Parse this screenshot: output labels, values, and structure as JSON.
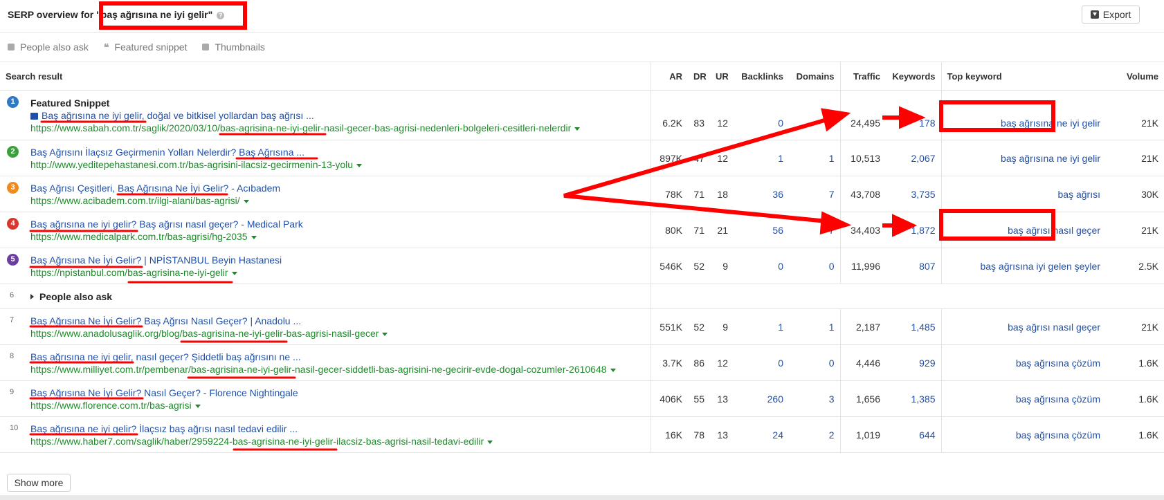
{
  "header": {
    "title_prefix": "SERP overview for ",
    "query": "\"baş ağrısına ne iyi gelir\"",
    "help": "?",
    "export_label": "Export"
  },
  "features": [
    {
      "label": "People also ask",
      "icon": "chat-icon"
    },
    {
      "label": "Featured snippet",
      "icon": "quote-icon"
    },
    {
      "label": "Thumbnails",
      "icon": "image-icon"
    }
  ],
  "columns": {
    "result": "Search result",
    "ar": "AR",
    "dr": "DR",
    "ur": "UR",
    "backlinks": "Backlinks",
    "domains": "Domains",
    "traffic": "Traffic",
    "keywords": "Keywords",
    "top_keyword": "Top keyword",
    "volume": "Volume"
  },
  "featured_label": "Featured Snippet",
  "paa_label": "People also ask",
  "paa_pos": "6",
  "rows": [
    {
      "pos": "1",
      "badge_color": "#2f78c4",
      "title": "Baş ağrısına ne iyi gelir, doğal ve bitkisel yollardan baş ağrısı ...",
      "url": "https://www.sabah.com.tr/saglik/2020/03/10/bas-agrisina-ne-iyi-gelir-nasil-gecer-bas-agrisi-nedenleri-bolgeleri-cesitleri-nelerdir",
      "ar": "6.2K",
      "dr": "83",
      "ur": "12",
      "backlinks": "0",
      "domains": "0",
      "traffic": "24,495",
      "keywords": "178",
      "top_keyword": "baş ağrısına ne iyi gelir",
      "volume": "21K"
    },
    {
      "pos": "2",
      "badge_color": "#3aa03a",
      "title": "Baş Ağrısını İlaçsız Geçirmenin Yolları Nelerdir? Baş Ağrısına ...",
      "url": "http://www.yeditepehastanesi.com.tr/bas-agrisini-ilacsiz-gecirmenin-13-yolu",
      "ar": "897K",
      "dr": "47",
      "ur": "12",
      "backlinks": "1",
      "domains": "1",
      "traffic": "10,513",
      "keywords": "2,067",
      "top_keyword": "baş ağrısına ne iyi gelir",
      "volume": "21K"
    },
    {
      "pos": "3",
      "badge_color": "#f08a1c",
      "title": "Baş Ağrısı Çeşitleri, Baş Ağrısına Ne İyi Gelir? - Acıbadem",
      "url": "https://www.acibadem.com.tr/ilgi-alani/bas-agrisi/",
      "ar": "78K",
      "dr": "71",
      "ur": "18",
      "backlinks": "36",
      "domains": "7",
      "traffic": "43,708",
      "keywords": "3,735",
      "top_keyword": "baş ağrısı",
      "volume": "30K"
    },
    {
      "pos": "4",
      "badge_color": "#d9362c",
      "title": "Baş ağrısına ne iyi gelir? Baş ağrısı nasıl geçer? - Medical Park",
      "url": "https://www.medicalpark.com.tr/bas-agrisi/hg-2035",
      "ar": "80K",
      "dr": "71",
      "ur": "21",
      "backlinks": "56",
      "domains": "7",
      "traffic": "34,403",
      "keywords": "1,872",
      "top_keyword": "baş ağrısı nasıl geçer",
      "volume": "21K"
    },
    {
      "pos": "5",
      "badge_color": "#6a3fa0",
      "title": "Baş Ağrısına Ne İyi Gelir? | NPİSTANBUL Beyin Hastanesi",
      "url": "https://npistanbul.com/bas-agrisina-ne-iyi-gelir",
      "ar": "546K",
      "dr": "52",
      "ur": "9",
      "backlinks": "0",
      "domains": "0",
      "traffic": "11,996",
      "keywords": "807",
      "top_keyword": "baş ağrısına iyi gelen şeyler",
      "volume": "2.5K"
    },
    {
      "pos": "7",
      "badge_color": "",
      "title": "Baş Ağrısına Ne İyi Gelir? Baş Ağrısı Nasıl Geçer? | Anadolu ...",
      "url": "https://www.anadolusaglik.org/blog/bas-agrisina-ne-iyi-gelir-bas-agrisi-nasil-gecer",
      "ar": "551K",
      "dr": "52",
      "ur": "9",
      "backlinks": "1",
      "domains": "1",
      "traffic": "2,187",
      "keywords": "1,485",
      "top_keyword": "baş ağrısı nasıl geçer",
      "volume": "21K"
    },
    {
      "pos": "8",
      "badge_color": "",
      "title": "Baş ağrısına ne iyi gelir, nasıl geçer? Şiddetli baş ağrısını ne ...",
      "url": "https://www.milliyet.com.tr/pembenar/bas-agrisina-ne-iyi-gelir-nasil-gecer-siddetli-bas-agrisini-ne-gecirir-evde-dogal-cozumler-2610648",
      "ar": "3.7K",
      "dr": "86",
      "ur": "12",
      "backlinks": "0",
      "domains": "0",
      "traffic": "4,446",
      "keywords": "929",
      "top_keyword": "baş ağrısına çözüm",
      "volume": "1.6K"
    },
    {
      "pos": "9",
      "badge_color": "",
      "title": "Baş Ağrısına Ne İyi Gelir? Nasıl Geçer? - Florence Nightingale",
      "url": "https://www.florence.com.tr/bas-agrisi",
      "ar": "406K",
      "dr": "55",
      "ur": "13",
      "backlinks": "260",
      "domains": "3",
      "traffic": "1,656",
      "keywords": "1,385",
      "top_keyword": "baş ağrısına çözüm",
      "volume": "1.6K"
    },
    {
      "pos": "10",
      "badge_color": "",
      "title": "Baş ağrısına ne iyi gelir? İlaçsız baş ağrısı nasıl tedavi edilir ...",
      "url": "https://www.haber7.com/saglik/haber/2959224-bas-agrisina-ne-iyi-gelir-ilacsiz-bas-agrisi-nasil-tedavi-edilir",
      "ar": "16K",
      "dr": "78",
      "ur": "13",
      "backlinks": "24",
      "domains": "2",
      "traffic": "1,019",
      "keywords": "644",
      "top_keyword": "baş ağrısına çözüm",
      "volume": "1.6K"
    }
  ],
  "show_more_label": "Show more",
  "annotation_color": "#ff0000"
}
